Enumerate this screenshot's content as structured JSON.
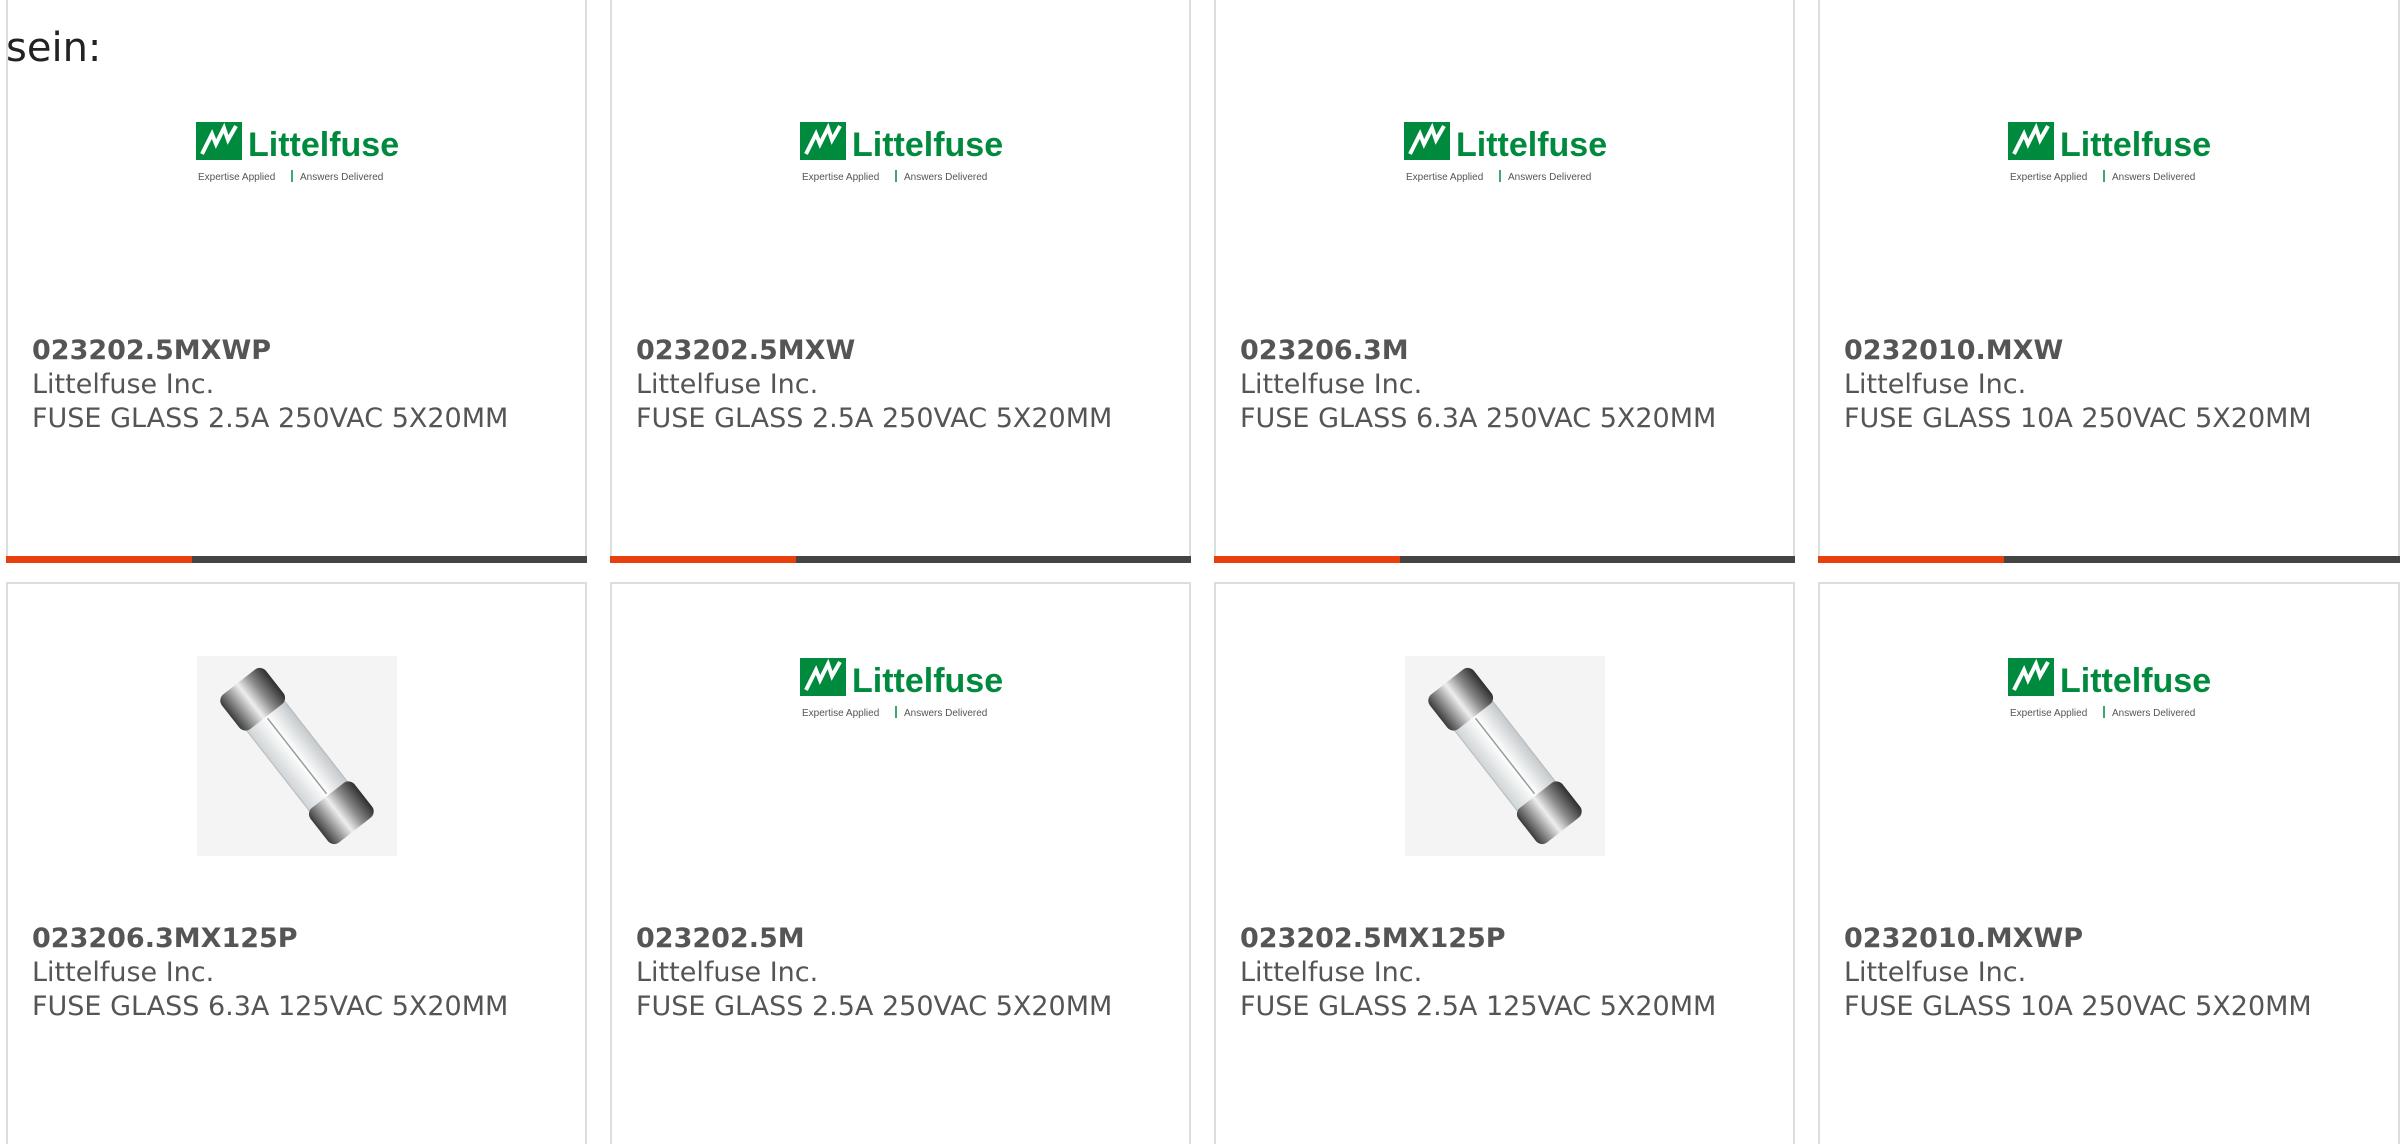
{
  "intro_text": "sein:",
  "colors": {
    "accent": "#e8400c",
    "bar_dark": "#444444",
    "logo_green": "#008a3e",
    "text": "#555555",
    "border": "#dddddd"
  },
  "products": [
    {
      "part_number": "023202.5MXWP",
      "manufacturer": "Littelfuse Inc.",
      "description": "FUSE GLASS 2.5A 250VAC 5X20MM",
      "image": "littelfuse-logo",
      "progress": 0.32
    },
    {
      "part_number": "023202.5MXW",
      "manufacturer": "Littelfuse Inc.",
      "description": "FUSE GLASS 2.5A 250VAC 5X20MM",
      "image": "littelfuse-logo",
      "progress": 0.32
    },
    {
      "part_number": "023206.3M",
      "manufacturer": "Littelfuse Inc.",
      "description": "FUSE GLASS 6.3A 250VAC 5X20MM",
      "image": "littelfuse-logo",
      "progress": 0.32
    },
    {
      "part_number": "0232010.MXW",
      "manufacturer": "Littelfuse Inc.",
      "description": "FUSE GLASS 10A 250VAC 5X20MM",
      "image": "littelfuse-logo",
      "progress": 0.32
    },
    {
      "part_number": "023206.3MX125P",
      "manufacturer": "Littelfuse Inc.",
      "description": "FUSE GLASS 6.3A 125VAC 5X20MM",
      "image": "glass-fuse-photo"
    },
    {
      "part_number": "023202.5M",
      "manufacturer": "Littelfuse Inc.",
      "description": "FUSE GLASS 2.5A 250VAC 5X20MM",
      "image": "littelfuse-logo"
    },
    {
      "part_number": "023202.5MX125P",
      "manufacturer": "Littelfuse Inc.",
      "description": "FUSE GLASS 2.5A 125VAC 5X20MM",
      "image": "glass-fuse-photo"
    },
    {
      "part_number": "0232010.MXWP",
      "manufacturer": "Littelfuse Inc.",
      "description": "FUSE GLASS 10A 250VAC 5X20MM",
      "image": "littelfuse-logo"
    }
  ],
  "logo": {
    "brand": "Littelfuse",
    "tagline_left": "Expertise Applied",
    "tagline_right": "Answers Delivered"
  }
}
